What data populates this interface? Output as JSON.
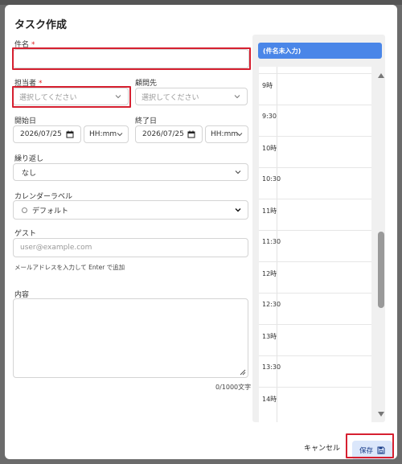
{
  "dialog": {
    "title": "タスク作成"
  },
  "subject": {
    "label": "件名",
    "required_mark": "*",
    "value": ""
  },
  "assignee": {
    "label": "担当者",
    "required_mark": "*",
    "placeholder": "選択してください"
  },
  "client": {
    "label": "顧問先",
    "placeholder": "選択してください"
  },
  "start": {
    "label": "開始日",
    "date": "2026/07/25",
    "time_placeholder": "HH:mm"
  },
  "end": {
    "label": "終了日",
    "date": "2026/07/25",
    "time_placeholder": "HH:mm"
  },
  "repeat": {
    "label": "繰り返し",
    "value": "なし"
  },
  "calendar_label": {
    "label": "カレンダーラベル",
    "value": "デフォルト"
  },
  "guest": {
    "label": "ゲスト",
    "placeholder": "user@example.com",
    "hint": "メールアドレスを入力して Enter で追加"
  },
  "content": {
    "label": "内容",
    "counter": "0/1000文字"
  },
  "calendar_panel": {
    "event_title": "(件名未入力)",
    "times": [
      "9時",
      "9:30",
      "10時",
      "10:30",
      "11時",
      "11:30",
      "12時",
      "12:30",
      "13時",
      "13:30",
      "14時"
    ]
  },
  "footer": {
    "cancel_label": "キャンセル",
    "save_label": "保存"
  },
  "colors": {
    "highlight": "#d62030",
    "event": "#4a86e8",
    "save_bg": "#dbe7fb"
  }
}
